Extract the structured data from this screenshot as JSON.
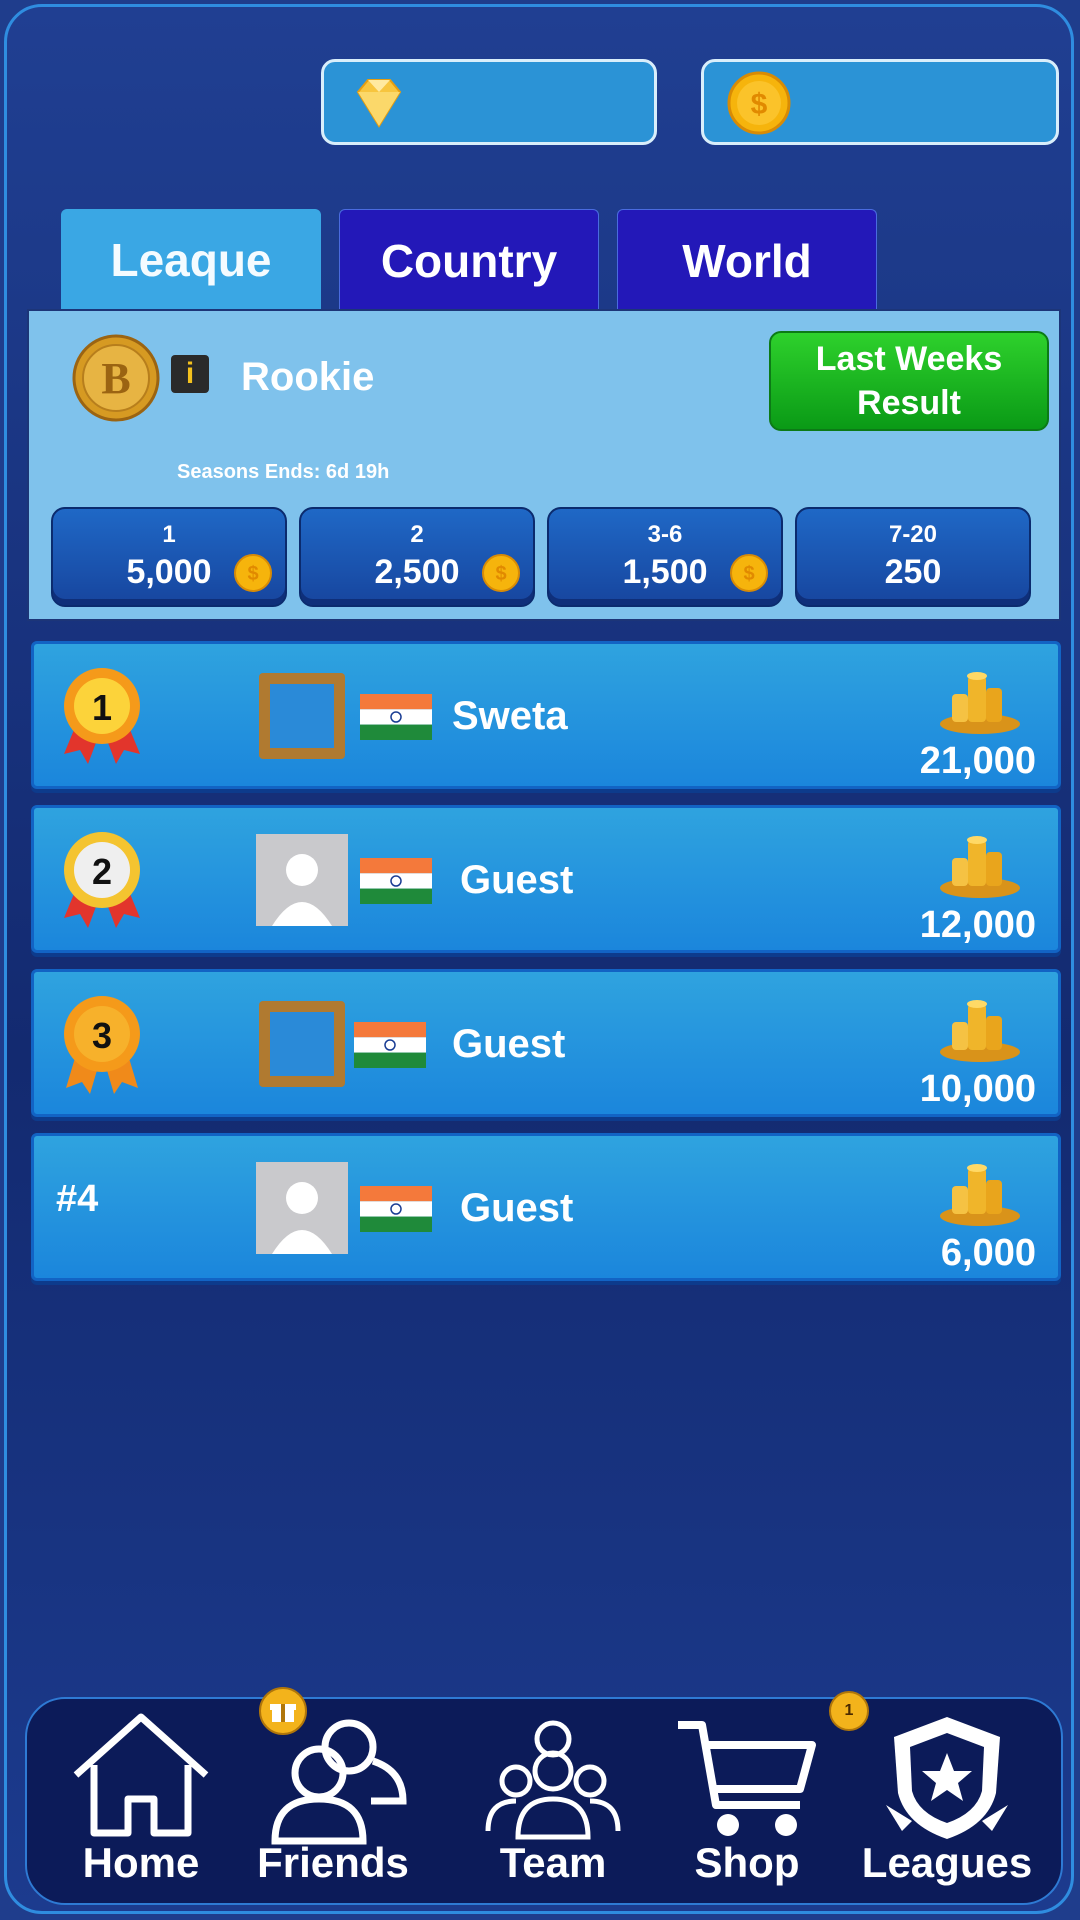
{
  "currency": {
    "gems": {
      "icon": "diamond-icon",
      "value": ""
    },
    "coins": {
      "icon": "dollar-coin-icon",
      "value": ""
    }
  },
  "tabs": [
    {
      "label": "Leaque",
      "active": true
    },
    {
      "label": "Country",
      "active": false
    },
    {
      "label": "World",
      "active": false
    }
  ],
  "league": {
    "badge_icon": "b-coin-badge-icon",
    "tier_icon": "info-icon",
    "tier_name": "Rookie",
    "last_weeks_line1": "Last Weeks",
    "last_weeks_line2": "Result",
    "season_ends": "Seasons Ends: 6d 19h",
    "prizes": [
      {
        "rank": "1",
        "amount": "5,000",
        "coin": true
      },
      {
        "rank": "2",
        "amount": "2,500",
        "coin": true
      },
      {
        "rank": "3-6",
        "amount": "1,500",
        "coin": true
      },
      {
        "rank": "7-20",
        "amount": "250",
        "coin": false
      }
    ]
  },
  "leaderboard": [
    {
      "rank": "1",
      "medal": "gold-medal-icon",
      "avatar": "frame-avatar",
      "flag": "india-flag-icon",
      "name": "Sweta",
      "score": "21,000"
    },
    {
      "rank": "2",
      "medal": "silver-medal-icon",
      "avatar": "default-avatar",
      "flag": "india-flag-icon",
      "name": "Guest",
      "score": "12,000"
    },
    {
      "rank": "3",
      "medal": "bronze-medal-icon",
      "avatar": "frame-avatar",
      "flag": "india-flag-icon",
      "name": "Guest",
      "score": "10,000"
    },
    {
      "rank": "#4",
      "medal": null,
      "avatar": "default-avatar",
      "flag": "india-flag-icon",
      "name": "Guest",
      "score": "6,000"
    }
  ],
  "nav": [
    {
      "label": "Home",
      "icon": "home-icon"
    },
    {
      "label": "Friends",
      "icon": "friends-icon",
      "badge_icon": "gift-icon"
    },
    {
      "label": "Team",
      "icon": "team-icon"
    },
    {
      "label": "Shop",
      "icon": "cart-icon",
      "badge": "1"
    },
    {
      "label": "Leagues",
      "icon": "leagues-shield-icon"
    }
  ],
  "colors": {
    "background": "#1f3d8c",
    "accent": "#2b93d6",
    "row": "#1b86dc",
    "panel": "#7fc2ec",
    "cta_green": "#0a9a16",
    "tab_active": "#3aa7e4",
    "tab_inactive": "#2318b8",
    "nav_bg": "#0c1b59"
  }
}
